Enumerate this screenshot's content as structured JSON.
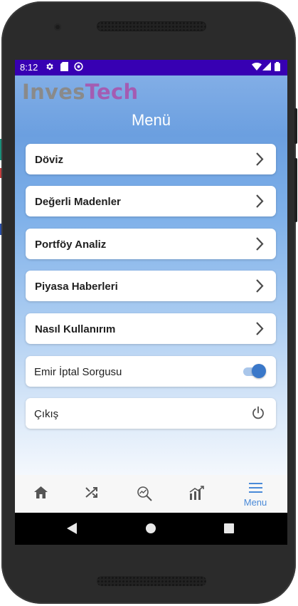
{
  "status_bar": {
    "time": "8:12"
  },
  "app": {
    "logo_part1": "Inves",
    "logo_part2": "Tech",
    "title": "Menü"
  },
  "menu": {
    "doviz": "Döviz",
    "degerli_madenler": "Değerli Madenler",
    "portfoy_analiz": "Portföy Analiz",
    "piyasa_haberleri": "Piyasa Haberleri",
    "nasil_kullanirim": "Nasıl Kullanırım",
    "emir_iptal": "Emir İptal Sorgusu",
    "emir_iptal_enabled": true,
    "cikis": "Çıkış"
  },
  "tabbar": {
    "active_label": "Menu",
    "active_color": "#4a8ad8",
    "icons": [
      "home-icon",
      "shuffle-icon",
      "search-chart-icon",
      "growth-chart-icon",
      "menu-icon"
    ]
  }
}
